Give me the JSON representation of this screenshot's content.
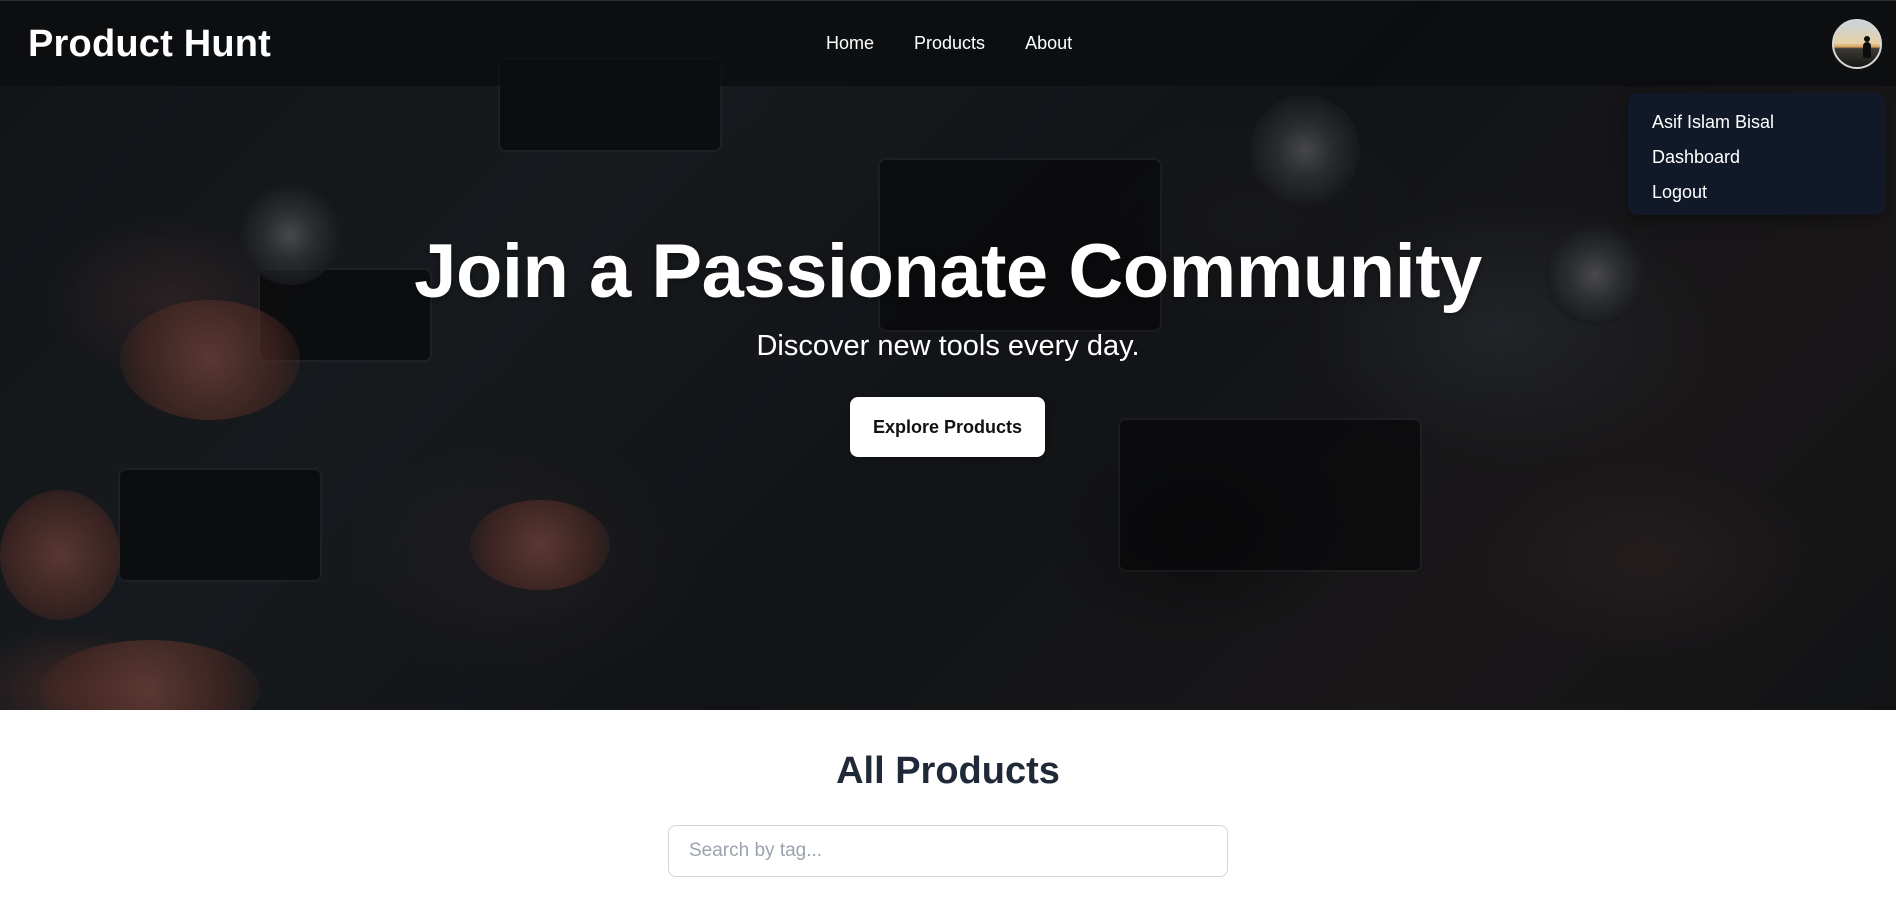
{
  "navbar": {
    "brand": "Product Hunt",
    "links": [
      "Home",
      "Products",
      "About"
    ]
  },
  "user_menu": {
    "items": [
      "Asif Islam Bisal",
      "Dashboard",
      "Logout"
    ]
  },
  "hero": {
    "title": "Join a Passionate Community",
    "subtitle": "Discover new tools every day.",
    "cta_label": "Explore Products"
  },
  "products": {
    "heading": "All Products",
    "search_placeholder": "Search by tag..."
  },
  "colors": {
    "dropdown_bg": "#111827",
    "heading_text": "#1f2937",
    "navbar_bg": "#0a0c0e"
  },
  "icons": {
    "avatar": "user-avatar-photo"
  }
}
